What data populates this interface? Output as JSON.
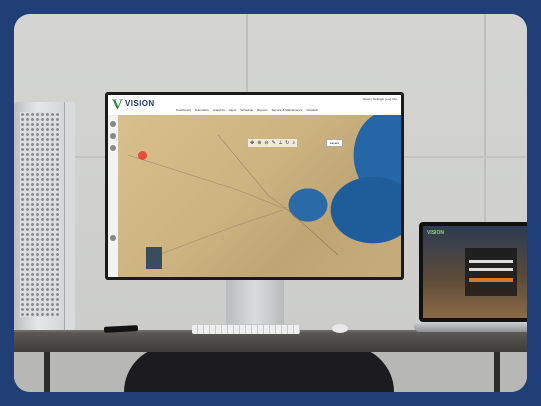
{
  "monitor_app": {
    "logo_letter": "V",
    "logo_name": "VISION",
    "logo_tagline": "",
    "utility_links": "News | Settings | Log Out",
    "nav": [
      "Dashboard",
      "Telematics",
      "Analytics",
      "Alerts",
      "Schedule",
      "Reports",
      "Service & Maintenance",
      "Dispatch"
    ],
    "layers_label": "Layers",
    "scale_text": ""
  },
  "laptop_app": {
    "logo_name": "VISION"
  },
  "colors": {
    "frame": "#1f3f76",
    "brand_green": "#2c8a3a",
    "brand_blue": "#1b3c73",
    "sea": "#1f5d9a",
    "desert": "#cdb380"
  }
}
